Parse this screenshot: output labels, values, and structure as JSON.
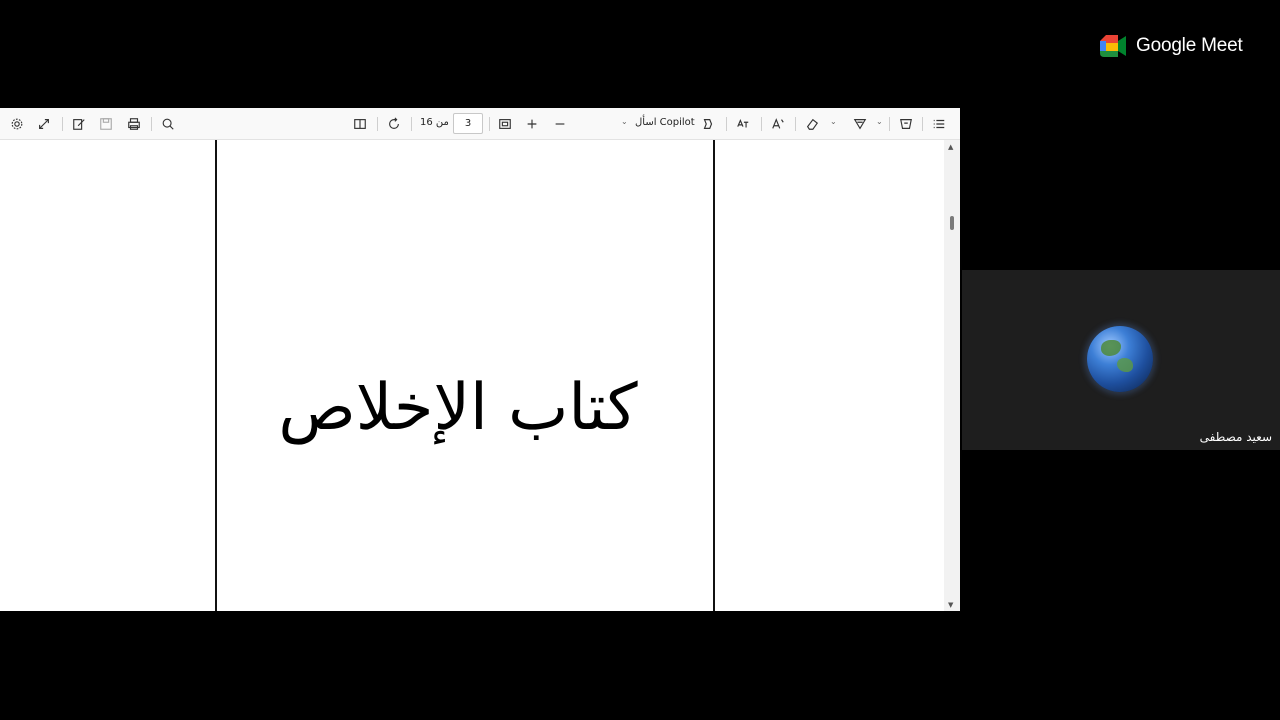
{
  "toolbar": {
    "page_current": "3",
    "page_of": "من 16",
    "copilot_label": "اسأل Copilot",
    "icons": [
      "settings-icon",
      "expand-icon",
      "edit-icon",
      "save-icon",
      "print-icon",
      "search-icon",
      "view-icon",
      "rotate-icon",
      "fit-icon",
      "plus-icon",
      "minus-icon",
      "copilot-icon",
      "translate-icon",
      "read-aloud-icon",
      "eraser-icon",
      "highlight-icon",
      "draw-icon",
      "contents-icon"
    ]
  },
  "document": {
    "title_text": "كتاب الإخلاص"
  },
  "meet": {
    "brand": "Google Meet",
    "participant_name": "سعيد مصطفى"
  },
  "colors": {
    "background": "#000000",
    "tile": "#1e1e1e"
  }
}
